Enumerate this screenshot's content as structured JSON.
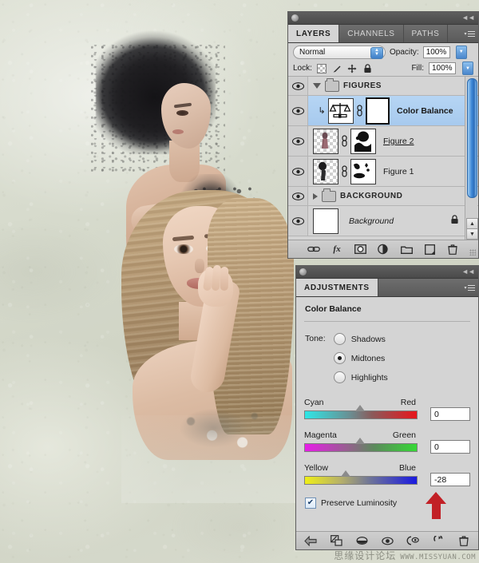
{
  "app": "Adobe Photoshop",
  "layers_panel": {
    "tabs": [
      {
        "label": "LAYERS",
        "active": true
      },
      {
        "label": "CHANNELS",
        "active": false
      },
      {
        "label": "PATHS",
        "active": false
      }
    ],
    "menu_icon": "panel-menu-icon",
    "collapse_icon": "collapse-to-icons-icon",
    "blend_mode": "Normal",
    "opacity_label": "Opacity:",
    "opacity_value": "100%",
    "lock_label": "Lock:",
    "lock_icons": [
      "lock-transparent-pixels-icon",
      "lock-image-pixels-icon",
      "lock-position-icon",
      "lock-all-icon"
    ],
    "fill_label": "Fill:",
    "fill_value": "100%",
    "rows": [
      {
        "kind": "group",
        "name": "FIGURES",
        "expanded": true,
        "visible": true,
        "selected": false
      },
      {
        "kind": "adjustment",
        "name": "Color Balance",
        "visible": true,
        "selected": true,
        "clipped": true,
        "has_mask": true
      },
      {
        "kind": "layer",
        "name": "Figure 2",
        "visible": true,
        "selected": false,
        "underline": true,
        "has_mask": true
      },
      {
        "kind": "layer",
        "name": "Figure 1",
        "visible": true,
        "selected": false,
        "underline": false,
        "has_mask": true
      },
      {
        "kind": "group",
        "name": "BACKGROUND",
        "expanded": false,
        "visible": true,
        "selected": false
      },
      {
        "kind": "layer",
        "name": "Background",
        "visible": true,
        "selected": false,
        "italic": true,
        "locked": true
      }
    ],
    "footer_icons": [
      "link-layers-icon",
      "add-layer-style-icon",
      "add-layer-mask-icon",
      "new-adjustment-layer-icon",
      "new-group-icon",
      "new-layer-icon",
      "delete-layer-icon"
    ]
  },
  "adjustments_panel": {
    "tab_label": "ADJUSTMENTS",
    "menu_icon": "panel-menu-icon",
    "collapse_icon": "collapse-to-icons-icon",
    "title": "Color Balance",
    "tone_label": "Tone:",
    "tone_options": [
      {
        "label": "Shadows",
        "selected": false
      },
      {
        "label": "Midtones",
        "selected": true
      },
      {
        "label": "Highlights",
        "selected": false
      }
    ],
    "sliders": [
      {
        "left_label": "Cyan",
        "right_label": "Red",
        "value": "0",
        "knob_percent": 50,
        "gradient": "linear-gradient(90deg,#2ee6e6 0%,#6a8f93 40%,#8a5a5a 60%,#e8151b 100%)"
      },
      {
        "left_label": "Magenta",
        "right_label": "Green",
        "value": "0",
        "knob_percent": 50,
        "gradient": "linear-gradient(90deg,#e81ce8 0%,#96608f 38%,#5c8a5c 62%,#36d836 100%)"
      },
      {
        "left_label": "Yellow",
        "right_label": "Blue",
        "value": "-28",
        "knob_percent": 36,
        "gradient": "linear-gradient(90deg,#efef18 0%,#b6b06a 32%,#6f7598 58%,#1a1ae0 100%)"
      }
    ],
    "preserve_luminosity_label": "Preserve Luminosity",
    "preserve_luminosity_checked": true,
    "footer_icons": [
      "return-to-adjustment-list-icon",
      "clip-to-layer-icon",
      "toggle-layer-visibility-icon",
      "preview-eye-icon",
      "view-previous-state-icon",
      "reset-adjustment-icon",
      "delete-adjustment-icon"
    ],
    "arrow_annotation": "red-arrow-annotation",
    "arrow_color": "#c22026"
  },
  "watermark": {
    "chinese": "思缘设计论坛",
    "url": "WWW.MISSYUAN.COM"
  },
  "colors": {
    "panel_bg": "#d4d4d4",
    "panel_header": "#5a5a5a",
    "selection_blue": "#a7caee",
    "accent_red": "#c22026"
  }
}
